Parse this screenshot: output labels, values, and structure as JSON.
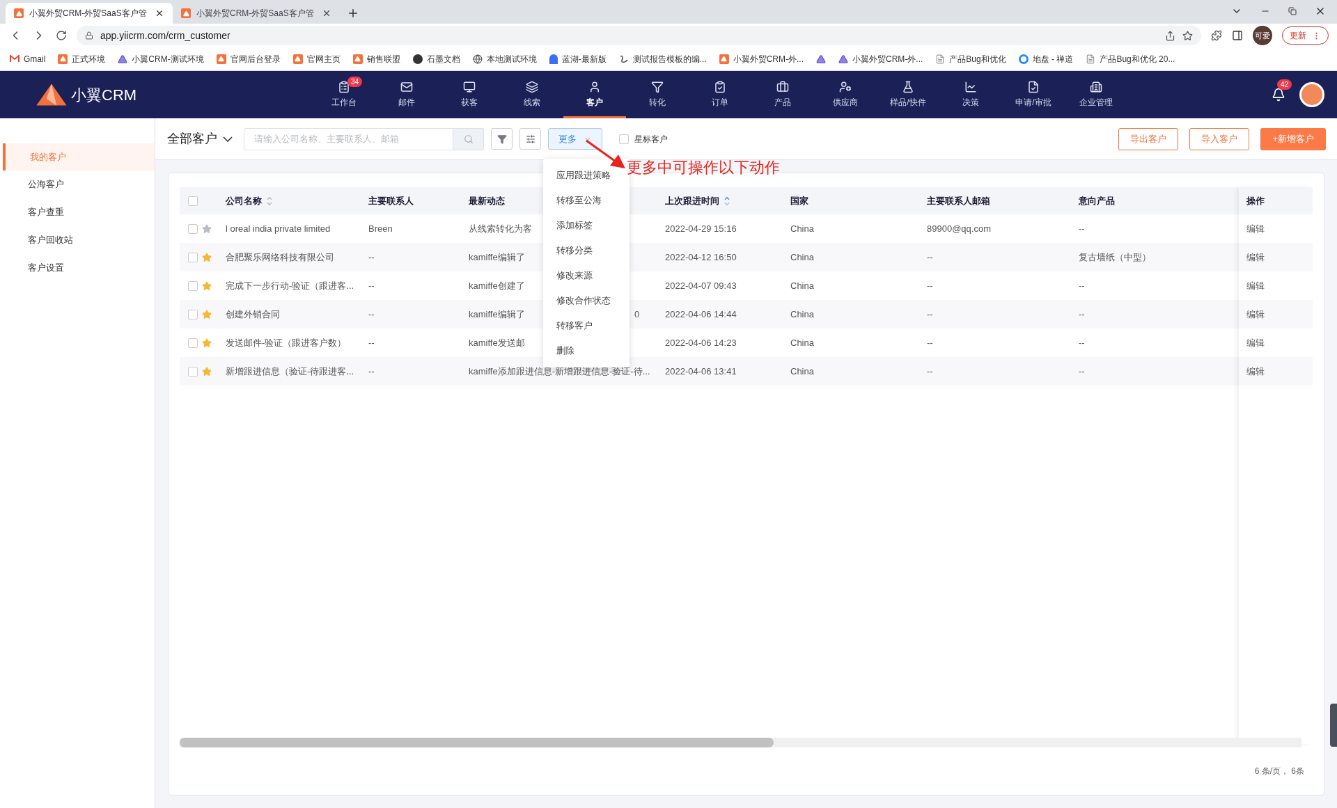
{
  "browser": {
    "tabs": [
      {
        "title": "小翼外贸CRM-外贸SaaS客户管",
        "selected": true
      },
      {
        "title": "小翼外贸CRM-外贸SaaS客户管",
        "selected": false
      }
    ],
    "url": "app.yiicrm.com/crm_customer",
    "profile": "可爱",
    "update_button": "更新",
    "bookmarks": [
      {
        "kind": "link",
        "label": "Gmail"
      },
      {
        "kind": "link",
        "label": "正式环境"
      },
      {
        "kind": "link",
        "label": "小翼CRM-测试环境"
      },
      {
        "kind": "link",
        "label": "官网后台登录"
      },
      {
        "kind": "link",
        "label": "官网主页"
      },
      {
        "kind": "link",
        "label": "销售联盟"
      },
      {
        "kind": "link",
        "label": "石墨文档"
      },
      {
        "kind": "link",
        "label": "本地测试环境"
      },
      {
        "kind": "link",
        "label": "蓝湖-最新版"
      },
      {
        "kind": "link",
        "label": "测试报告模板的编..."
      },
      {
        "kind": "link",
        "label": "小翼外贸CRM-外..."
      },
      {
        "kind": "icon"
      },
      {
        "kind": "link",
        "label": "小翼外贸CRM-外..."
      },
      {
        "kind": "link",
        "label": "产品Bug和优化"
      },
      {
        "kind": "link",
        "label": "地盘 - 禅道"
      },
      {
        "kind": "link",
        "label": "产品Bug和优化 20..."
      }
    ]
  },
  "app": {
    "logo": "小翼CRM",
    "nav": [
      {
        "label": "工作台",
        "selected": false,
        "badge": "34"
      },
      {
        "label": "邮件",
        "selected": false
      },
      {
        "label": "获客",
        "selected": false
      },
      {
        "label": "线索",
        "selected": false
      },
      {
        "label": "客户",
        "selected": true
      },
      {
        "label": "转化",
        "selected": false
      },
      {
        "label": "订单",
        "selected": false
      },
      {
        "label": "产品",
        "selected": false
      },
      {
        "label": "供应商",
        "selected": false
      },
      {
        "label": "样品/快件",
        "selected": false
      },
      {
        "label": "决策",
        "selected": false
      },
      {
        "label": "申请/审批",
        "selected": false
      },
      {
        "label": "企业管理",
        "selected": false
      }
    ],
    "notification_badge": "42"
  },
  "sidebar": {
    "items": [
      {
        "label": "我的客户",
        "selected": true
      },
      {
        "label": "公海客户",
        "selected": false
      },
      {
        "label": "客户查重",
        "selected": false
      },
      {
        "label": "客户回收站",
        "selected": false
      },
      {
        "label": "客户设置",
        "selected": false
      }
    ]
  },
  "toolbar": {
    "scope": "全部客户",
    "search_placeholder": "请输入公司名称、主要联系人、邮箱",
    "more": "更多",
    "starred_filter": {
      "label": "星标客户",
      "checked": false
    },
    "buttons": [
      "导出客户",
      "导入客户",
      "+新增客户"
    ]
  },
  "more_menu": {
    "items": [
      "应用跟进策略",
      "转移至公海",
      "添加标签",
      "转移分类",
      "修改来源",
      "修改合作状态",
      "转移客户",
      "删除"
    ]
  },
  "annotation": "更多中可操作以下动作",
  "table": {
    "all_checked": false,
    "columns": [
      {
        "label": "公司名称",
        "sorted": false
      },
      {
        "label": "主要联系人"
      },
      {
        "label": "最新动态"
      },
      {
        "label": "上次跟进时间",
        "sorted": true
      },
      {
        "label": "国家"
      },
      {
        "label": "主要联系人邮箱"
      },
      {
        "label": "意向产品"
      }
    ],
    "actions_header": "操作",
    "rows": [
      {
        "checked": false,
        "starred": false,
        "company": "l oreal india private limited",
        "contact": "Breen",
        "latest": "从线索转化为客",
        "last_follow": "2022-04-29 15:16",
        "country": "China",
        "email": "89900@qq.com",
        "product": "--",
        "action": "编辑"
      },
      {
        "checked": false,
        "starred": true,
        "company": "合肥聚乐网络科技有限公司",
        "contact": "--",
        "latest": "kamiffe编辑了",
        "last_follow": "2022-04-12 16:50",
        "country": "China",
        "email": "--",
        "product": "复古墙纸（中型）",
        "action": "编辑"
      },
      {
        "checked": false,
        "starred": true,
        "company": "完成下一步行动-验证（跟进客...",
        "contact": "--",
        "latest": "kamiffe创建了",
        "last_follow": "2022-04-07 09:43",
        "country": "China",
        "email": "--",
        "product": "--",
        "action": "编辑"
      },
      {
        "checked": false,
        "starred": true,
        "company": "创建外销合同",
        "contact": "--",
        "latest": "kamiffe编辑了",
        "latest_tail": "0",
        "last_follow": "2022-04-06 14:44",
        "country": "China",
        "email": "--",
        "product": "--",
        "action": "编辑"
      },
      {
        "checked": false,
        "starred": true,
        "company": "发送邮件-验证（跟进客户数）",
        "contact": "--",
        "latest": "kamiffe发送邮",
        "last_follow": "2022-04-06 14:23",
        "country": "China",
        "email": "--",
        "product": "--",
        "action": "编辑"
      },
      {
        "checked": false,
        "starred": true,
        "company": "新增跟进信息（验证-待跟进客...",
        "contact": "--",
        "latest": "kamiffe添加跟进信息-新增跟进信息-验证-待...",
        "last_follow": "2022-04-06 13:41",
        "country": "China",
        "email": "--",
        "product": "--",
        "action": "编辑"
      }
    ],
    "pagination": "6 条/页， 6条"
  }
}
